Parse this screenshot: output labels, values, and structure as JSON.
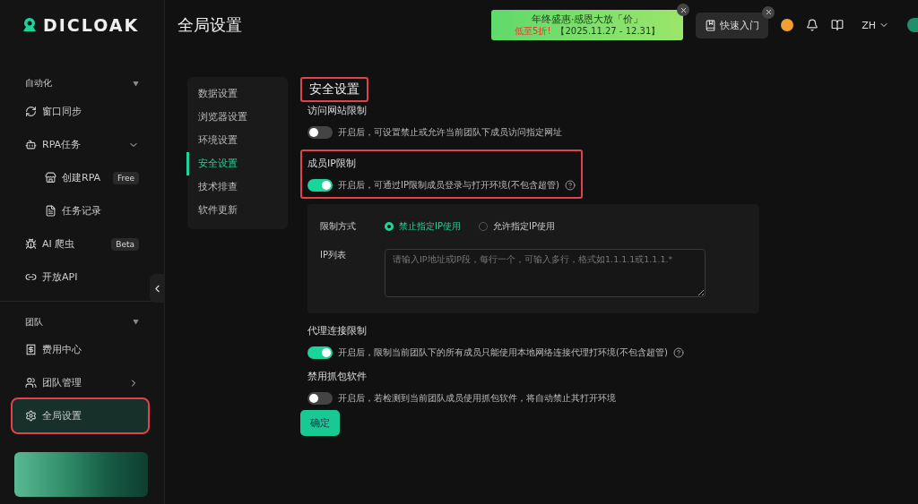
{
  "brand": {
    "name": "DICLOAK"
  },
  "page_title": "全局设置",
  "promo": {
    "title": "年终盛惠·感恩大放「价」",
    "discount": "低至5折!",
    "dates": "【2025.11.27 - 12.31】"
  },
  "quick_start": {
    "label": "快速入门"
  },
  "language": "ZH",
  "sidebar": {
    "sections": [
      {
        "label": "自动化",
        "expanded": true,
        "items": [
          {
            "label": "窗口同步",
            "selected": false
          },
          {
            "label": "RPA任务",
            "selected": false,
            "expanded": true,
            "children": [
              {
                "label": "创建RPA",
                "badge": "Free",
                "selected": false
              },
              {
                "label": "任务记录",
                "selected": false
              }
            ]
          },
          {
            "label": "AI 爬虫",
            "badge": "Beta",
            "selected": false
          },
          {
            "label": "开放API",
            "selected": false
          }
        ]
      },
      {
        "label": "团队",
        "expanded": true,
        "items": [
          {
            "label": "费用中心",
            "selected": false
          },
          {
            "label": "团队管理",
            "selected": false,
            "has_arrow": true
          },
          {
            "label": "全局设置",
            "selected": true,
            "highlighted": true
          }
        ]
      }
    ]
  },
  "settings_nav": [
    {
      "label": "数据设置",
      "selected": false
    },
    {
      "label": "浏览器设置",
      "selected": false
    },
    {
      "label": "环境设置",
      "selected": false
    },
    {
      "label": "安全设置",
      "selected": true
    },
    {
      "label": "技术排查",
      "selected": false
    },
    {
      "label": "软件更新",
      "selected": false
    }
  ],
  "section_title": "安全设置",
  "settings": [
    {
      "title": "访问网站限制",
      "on": false,
      "description": "开启后，可设置禁止或允许当前团队下成员访问指定网址",
      "help": false,
      "highlighted": false
    },
    {
      "title": "成员IP限制",
      "on": true,
      "description": "开启后，可通过IP限制成员登录与打开环境(不包含超管)",
      "help": true,
      "highlighted": true,
      "panel": {
        "mode_label": "限制方式",
        "modes": [
          {
            "label": "禁止指定IP使用",
            "selected": true
          },
          {
            "label": "允许指定IP使用",
            "selected": false
          }
        ],
        "list_label": "IP列表",
        "placeholder": "请输入IP地址或IP段，每行一个，可输入多行，格式如1.1.1.1或1.1.1.*"
      }
    },
    {
      "title": "代理连接限制",
      "on": true,
      "description": "开启后，限制当前团队下的所有成员只能使用本地网络连接代理打环境(不包含超管)",
      "help": true,
      "highlighted": false
    },
    {
      "title": "禁用抓包软件",
      "on": false,
      "description": "开启后，若检测到当前团队成员使用抓包软件，将自动禁止其打开环境",
      "help": false,
      "highlighted": false
    }
  ],
  "confirm_button": "确定"
}
